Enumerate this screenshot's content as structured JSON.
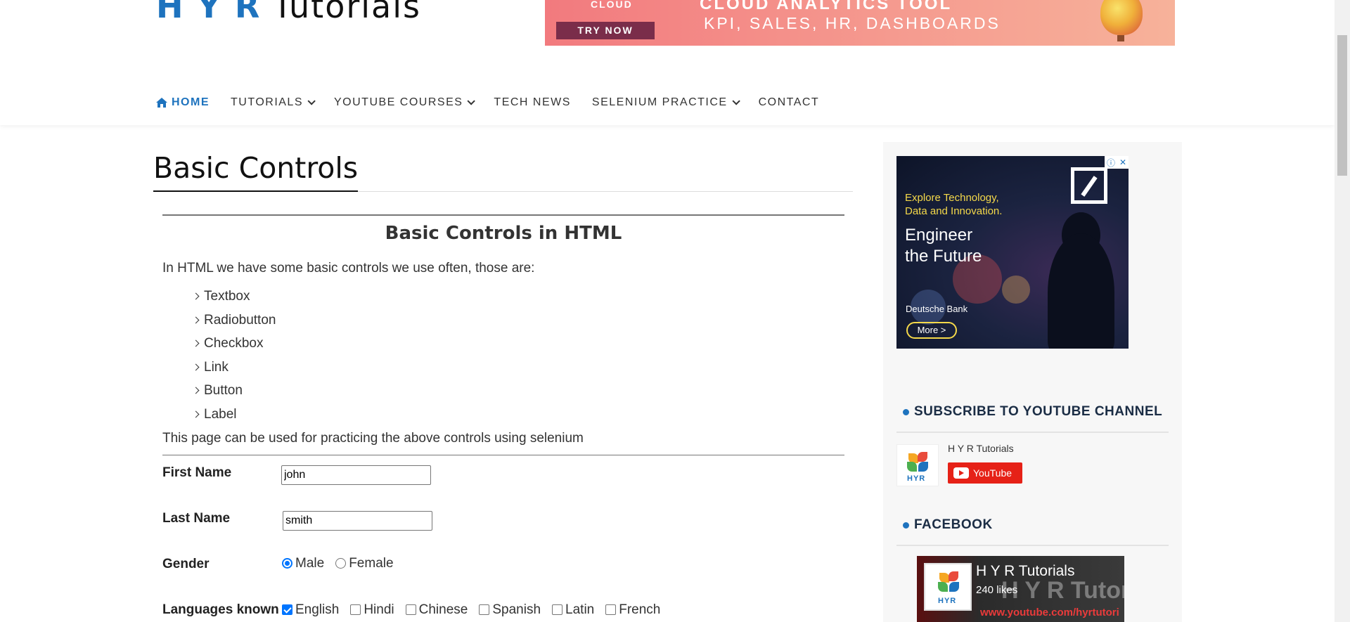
{
  "logo": {
    "hyr": "H Y R",
    "tutorials": "Tutorials"
  },
  "banner": {
    "cloud": "CLOUD",
    "try_now": "TRY NOW",
    "headline": "CLOUD ANALYTICS TOOL",
    "subline": "KPI, SALES, HR, DASHBOARDS"
  },
  "nav": {
    "home": "HOME",
    "tutorials": "TUTORIALS",
    "youtube_courses": "YOUTUBE COURSES",
    "tech_news": "TECH NEWS",
    "selenium_practice": "SELENIUM PRACTICE",
    "contact": "CONTACT"
  },
  "page": {
    "title": "Basic Controls",
    "subtitle": "Basic Controls in HTML",
    "intro": "In HTML we have some basic controls we use often, those are:",
    "controls": [
      "Textbox",
      "Radiobutton",
      "Checkbox",
      "Link",
      "Button",
      "Label"
    ],
    "note": "This page can be used for practicing the above controls using selenium"
  },
  "form": {
    "first_name_label": "First Name",
    "first_name_value": "john",
    "last_name_label": "Last Name",
    "last_name_value": "smith",
    "gender_label": "Gender",
    "gender_options": [
      "Male",
      "Female"
    ],
    "gender_selected": "Male",
    "languages_label": "Languages known",
    "languages": [
      "English",
      "Hindi",
      "Chinese",
      "Spanish",
      "Latin",
      "French"
    ],
    "languages_checked": [
      "English"
    ]
  },
  "sidebar": {
    "ad": {
      "line1a": "Explore Technology,",
      "line1b": "Data and Innovation.",
      "line2a": "Engineer",
      "line2b": "the Future",
      "brand": "Deutsche Bank",
      "more": "More >"
    },
    "subscribe_title": "SUBSCRIBE TO YOUTUBE CHANNEL",
    "yt_channel_name": "H Y R Tutorials",
    "yt_button": "YouTube",
    "logo_text": "HYR",
    "facebook_title": "FACEBOOK",
    "fb_page_name": "H Y R Tutorials",
    "fb_likes": "240 likes",
    "fb_banner_text": "H Y R Tutoria",
    "fb_banner_url": "www.youtube.com/hyrtutori"
  },
  "colors": {
    "accent": "#1e73be",
    "youtube_red": "#e62117",
    "checkbox_blue": "#0075ff"
  }
}
